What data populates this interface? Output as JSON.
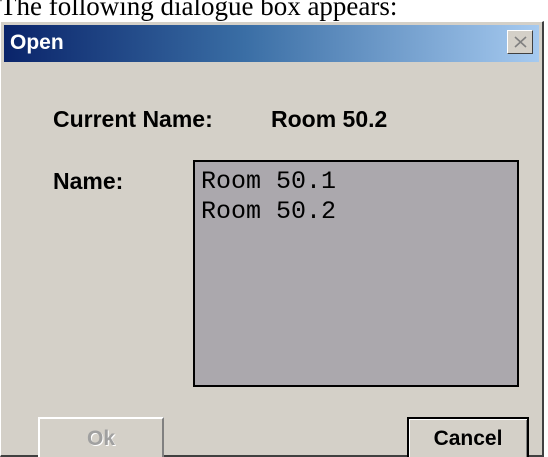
{
  "caption": "The following dialogue box appears:",
  "dialog": {
    "title": "Open",
    "current_name_label": "Current Name:",
    "current_name_value": "Room 50.2",
    "name_label": "Name:",
    "list_items": [
      "Room 50.1",
      "Room 50.2"
    ],
    "ok_label": "Ok",
    "cancel_label": "Cancel",
    "ok_enabled": false
  },
  "colors": {
    "titlebar_start": "#0a246a",
    "titlebar_end": "#a6caf0",
    "dialog_face": "#d4d0c8",
    "listbox_bg": "#aba8ad"
  },
  "icons": {
    "close": "close-icon"
  }
}
